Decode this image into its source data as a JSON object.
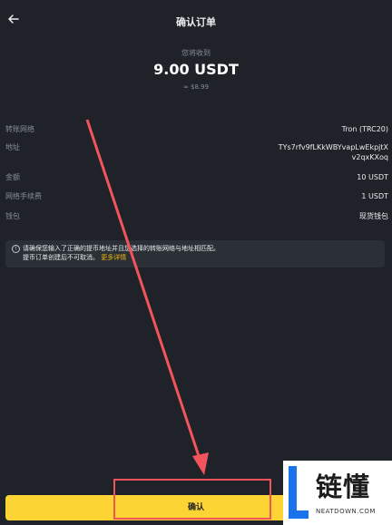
{
  "header": {
    "back_icon": "arrow-left-icon",
    "title": "确认订单"
  },
  "summary": {
    "receive_label": "您将收到",
    "amount": "9.00 USDT",
    "usd_value": "≈ $8.99"
  },
  "details": [
    {
      "label": "转账网络",
      "value": "Tron (TRC20)"
    },
    {
      "label": "地址",
      "value": "TYs7rfv9fLKkWBYvapLwEkpjtX",
      "value2": "v2qxKXoq"
    },
    {
      "label": "金额",
      "value": "10 USDT"
    },
    {
      "label": "网络手续费",
      "value": "1 USDT"
    },
    {
      "label": "钱包",
      "value": "现货钱包"
    }
  ],
  "notice": {
    "icon": "info-icon",
    "line1": "请确保您输入了正确的提币地址并且您选择的转账网络与地址相匹配。",
    "line2": "提币订单创建后不可取消。",
    "more_link": "更多详情"
  },
  "confirm_button": {
    "label": "确认"
  },
  "annotation": {
    "color": "#f2545b"
  },
  "watermark": {
    "brand": "链懂",
    "domain": "NEATDOWN.COM"
  },
  "colors": {
    "background": "#1f2228",
    "accent": "#fcd535",
    "link": "#f0b90b"
  }
}
